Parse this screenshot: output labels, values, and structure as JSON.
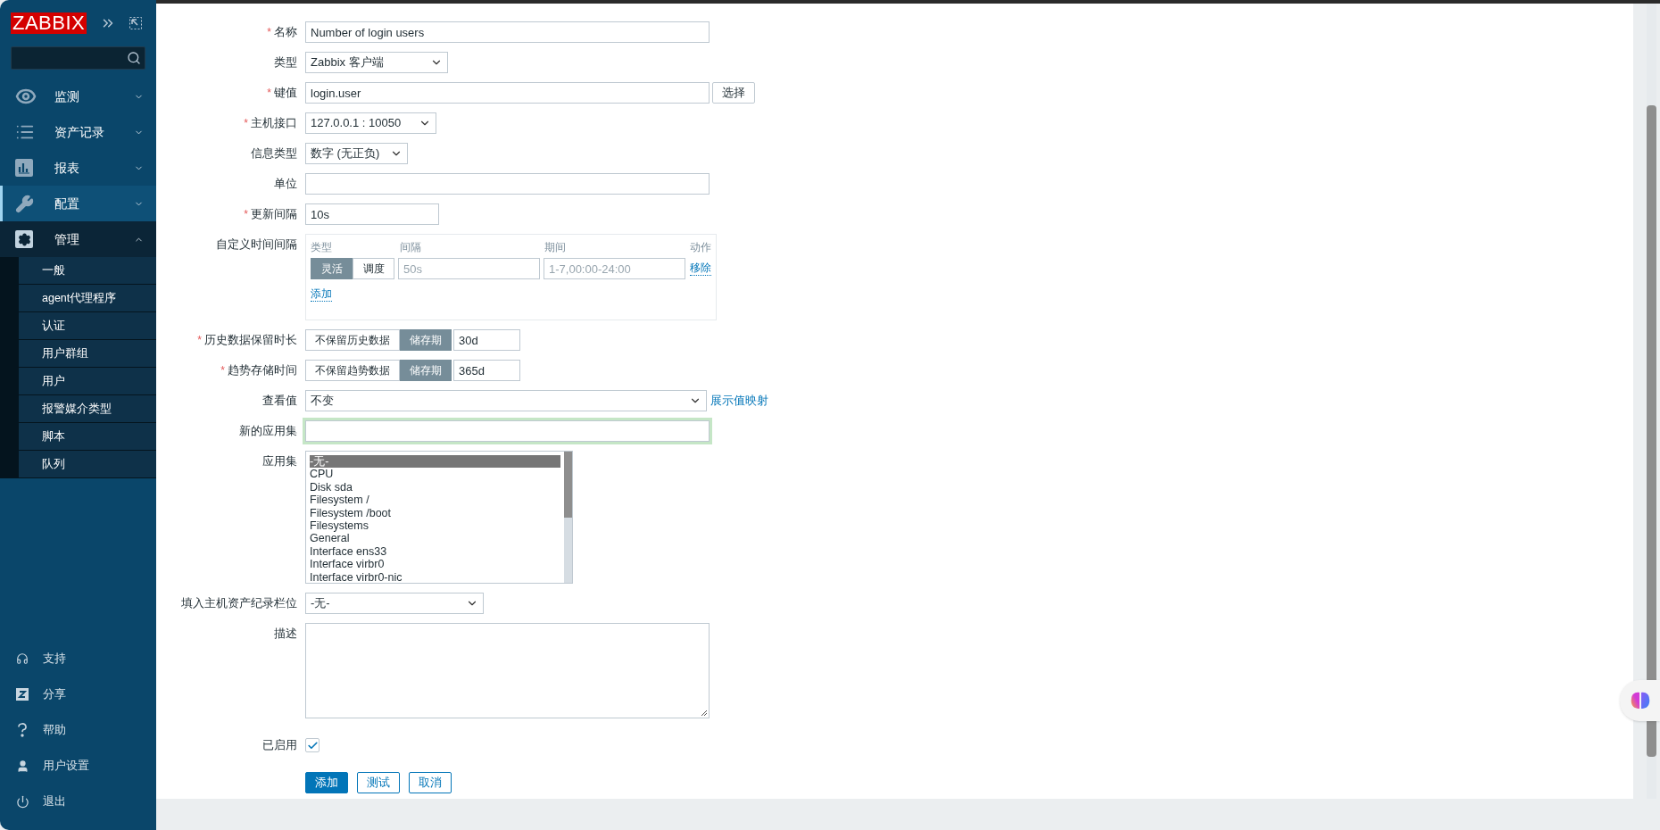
{
  "sidebar": {
    "logo": "ZABBIX",
    "menu": [
      {
        "label": "监测",
        "selected": false,
        "expanded": false
      },
      {
        "label": "资产记录",
        "selected": false,
        "expanded": false
      },
      {
        "label": "报表",
        "selected": false,
        "expanded": false
      },
      {
        "label": "配置",
        "selected": true,
        "expanded": false
      },
      {
        "label": "管理",
        "selected": false,
        "expanded": true,
        "children": [
          {
            "label": "一般",
            "selected": false
          },
          {
            "label": "agent代理程序",
            "selected": false
          },
          {
            "label": "认证",
            "selected": false
          },
          {
            "label": "用户群组",
            "selected": false
          },
          {
            "label": "用户",
            "selected": false
          },
          {
            "label": "报警媒介类型",
            "selected": false
          },
          {
            "label": "脚本",
            "selected": false
          },
          {
            "label": "队列",
            "selected": false
          }
        ]
      }
    ],
    "bottom_menu": [
      {
        "label": "支持"
      },
      {
        "label": "分享"
      },
      {
        "label": "帮助"
      },
      {
        "label": "用户设置"
      },
      {
        "label": "退出"
      }
    ]
  },
  "form": {
    "fields": [
      {
        "kind": "text",
        "required_mark": "*",
        "label": "名称",
        "value": "Number of login users"
      },
      {
        "kind": "select",
        "label": "类型",
        "value": "Zabbix 客户端"
      },
      {
        "kind": "text_button",
        "required_mark": "*",
        "label": "键值",
        "value": "login.user",
        "button": "选择"
      },
      {
        "kind": "select",
        "required_mark": "*",
        "label": "主机接口",
        "value": "127.0.0.1 : 10050"
      },
      {
        "kind": "select",
        "label": "信息类型",
        "value": "数字 (无正负)"
      },
      {
        "kind": "text",
        "label": "单位"
      },
      {
        "kind": "text",
        "required_mark": "*",
        "label": "更新间隔",
        "value": "10s"
      },
      {
        "kind": "intervals",
        "label": "自定义时间间隔",
        "columns": [
          "类型",
          "间隔",
          "期间",
          "动作"
        ],
        "rows": [
          {
            "modes": [
              {
                "label": "灵活",
                "selected": true
              },
              {
                "label": "调度",
                "selected": false
              }
            ],
            "interval_placeholder": "50s",
            "period_placeholder": "1-7,00:00-24:00",
            "action": "移除"
          }
        ],
        "add_link": "添加"
      },
      {
        "kind": "storage",
        "required_mark": "*",
        "label": "历史数据保留时长",
        "options": [
          {
            "label": "不保留历史数据",
            "selected": false
          },
          {
            "label": "储存期",
            "selected": true
          }
        ],
        "value": "30d"
      },
      {
        "kind": "storage",
        "required_mark": "*",
        "label": "趋势存储时间",
        "options": [
          {
            "label": "不保留趋势数据",
            "selected": false
          },
          {
            "label": "储存期",
            "selected": true
          }
        ],
        "value": "365d"
      },
      {
        "kind": "select_link",
        "label": "查看值",
        "value": "不变",
        "link": "展示值映射"
      },
      {
        "kind": "text",
        "label": "新的应用集",
        "focused": true
      },
      {
        "kind": "listbox",
        "label": "应用集",
        "options": [
          {
            "label": "-无-",
            "selected": true
          },
          {
            "label": "CPU",
            "selected": false
          },
          {
            "label": "Disk sda",
            "selected": false
          },
          {
            "label": "Filesystem /",
            "selected": false
          },
          {
            "label": "Filesystem /boot",
            "selected": false
          },
          {
            "label": "Filesystems",
            "selected": false
          },
          {
            "label": "General",
            "selected": false
          },
          {
            "label": "Interface ens33",
            "selected": false
          },
          {
            "label": "Interface virbr0",
            "selected": false
          },
          {
            "label": "Interface virbr0-nic",
            "selected": false
          }
        ]
      },
      {
        "kind": "select",
        "label": "填入主机资产纪录栏位",
        "value": "-无-"
      },
      {
        "kind": "textarea",
        "label": "描述"
      },
      {
        "kind": "checkbox",
        "label": "已启用",
        "checked": true
      }
    ],
    "buttons": [
      {
        "label": "添加",
        "primary": true
      },
      {
        "label": "测试",
        "primary": false
      },
      {
        "label": "取消",
        "primary": false
      }
    ]
  }
}
